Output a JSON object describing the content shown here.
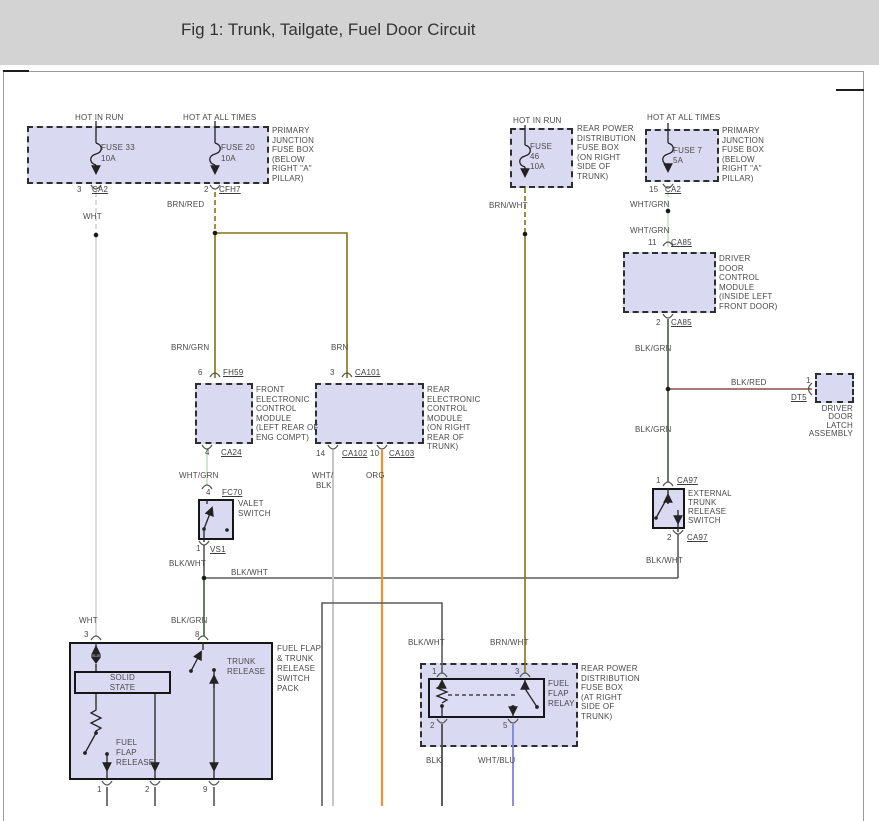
{
  "header": {
    "title": "Fig 1: Trunk, Tailgate, Fuel Door Circuit"
  },
  "wire_colors": {
    "WHT": "#dcdcdc",
    "BRN_RED": "#8a7211",
    "BRN_GRN": "#74790f",
    "BRN": "#8a7211",
    "BRN_WHT": "#8a7211",
    "WHT_GRN": "#d3e5d3",
    "BLK_GRN": "#3f5f3f",
    "BLK_WHT": "#5c5c5c",
    "WHT_BLK": "#c6c6c6",
    "ORG": "#ef9133",
    "BLK_RED": "#8c4f45",
    "BLK": "#4b4b4b",
    "WHT_BLU": "#8181de",
    "UNLABELED": "#777777"
  },
  "wires": {
    "wht": "WHT",
    "brn_red": "BRN/RED",
    "brn_grn": "BRN/GRN",
    "brn": "BRN",
    "brn_wht": "BRN/WHT",
    "wht_grn": "WHT/GRN",
    "blk_grn": "BLK/GRN",
    "blk_wht": "BLK/WHT",
    "wht_blk_1": "WHT/",
    "wht_blk_2": "BLK",
    "org": "ORG",
    "blk_red": "BLK/RED",
    "blk": "BLK",
    "wht_blu": "WHT/BLU"
  },
  "fuse_box_left": {
    "hot_in_run": "HOT IN RUN",
    "hot_at_all_times": "HOT AT ALL TIMES",
    "fuse33": [
      "FUSE 33",
      "10A"
    ],
    "fuse20": [
      "FUSE 20",
      "10A"
    ],
    "label": [
      "PRIMARY",
      "JUNCTION",
      "FUSE BOX",
      "(BELOW",
      "RIGHT \"A\"",
      "PILLAR)"
    ],
    "pin_left": {
      "num": "3",
      "connector": "CA2"
    },
    "pin_right": {
      "num": "2",
      "connector": "CFH7"
    }
  },
  "fuse_box_rear": {
    "hot_in_run": "HOT IN RUN",
    "fuse46": [
      "FUSE",
      "46",
      "10A"
    ],
    "label": [
      "REAR POWER",
      "DISTRIBUTION",
      "FUSE BOX",
      "(ON RIGHT",
      "SIDE OF",
      "TRUNK)"
    ]
  },
  "fuse_box_right": {
    "hot_at_all_times": "HOT AT ALL TIMES",
    "fuse7": [
      "FUSE 7",
      "5A"
    ],
    "label": [
      "PRIMARY",
      "JUNCTION",
      "FUSE BOX",
      "(BELOW",
      "RIGHT \"A\"",
      "PILLAR)"
    ],
    "pin": {
      "num": "15",
      "connector": "CA2"
    }
  },
  "front_ecm": {
    "pin_top": {
      "num": "6",
      "connector": "FH59"
    },
    "label": [
      "FRONT",
      "ELECTRONIC",
      "CONTROL",
      "MODULE",
      "(LEFT REAR OF",
      "ENG COMPT)"
    ],
    "pin_bottom": {
      "num": "4",
      "connector": "CA24"
    }
  },
  "rear_ecm": {
    "pin_top": {
      "num": "3",
      "connector": "CA101"
    },
    "label": [
      "REAR",
      "ELECTRONIC",
      "CONTROL",
      "MODULE",
      "(ON RIGHT",
      "REAR OF",
      "TRUNK)"
    ],
    "pin_bottom_left": {
      "num": "14",
      "connector": "CA102"
    },
    "pin_bottom_right": {
      "num": "10",
      "connector": "CA103"
    }
  },
  "driver_door_module": {
    "pin_top": {
      "num": "11",
      "connector": "CA85"
    },
    "label": [
      "DRIVER",
      "DOOR",
      "CONTROL",
      "MODULE",
      "(INSIDE LEFT",
      "FRONT DOOR)"
    ],
    "pin_bottom": {
      "num": "2",
      "connector": "CA85"
    }
  },
  "door_latch": {
    "pin": {
      "num": "1",
      "connector": "DT5"
    },
    "label": [
      "DRIVER",
      "DOOR",
      "LATCH",
      "ASSEMBLY"
    ]
  },
  "valet_switch": {
    "pin_top": {
      "num": "4",
      "connector": "FC70"
    },
    "label": [
      "VALET",
      "SWITCH"
    ],
    "pin_bottom": {
      "num": "1",
      "connector": "VS1"
    }
  },
  "ext_trunk_switch": {
    "pin_top": {
      "num": "1",
      "connector": "CA97"
    },
    "label": [
      "EXTERNAL",
      "TRUNK",
      "RELEASE",
      "SWITCH"
    ],
    "pin_bottom": {
      "num": "2",
      "connector": "CA97"
    }
  },
  "switch_pack": {
    "pin_3": "3",
    "pin_8": "8",
    "label": [
      "FUEL FLAP",
      "& TRUNK",
      "RELEASE",
      "SWITCH",
      "PACK"
    ],
    "solid_state": [
      "SOLID",
      "STATE"
    ],
    "trunk_release": [
      "TRUNK",
      "RELEASE"
    ],
    "fuel_flap_release": [
      "FUEL",
      "FLAP",
      "RELEASE"
    ],
    "pin_1": "1",
    "pin_2": "2",
    "pin_9": "9"
  },
  "relay": {
    "box_label": [
      "REAR POWER",
      "DISTRIBUTION",
      "FUSE BOX",
      "(AT RIGHT",
      "SIDE OF",
      "TRUNK)"
    ],
    "label": [
      "FUEL",
      "FLAP",
      "RELAY"
    ],
    "pin_1": "1",
    "pin_3": "3",
    "pin_2": "2",
    "pin_5": "5"
  }
}
